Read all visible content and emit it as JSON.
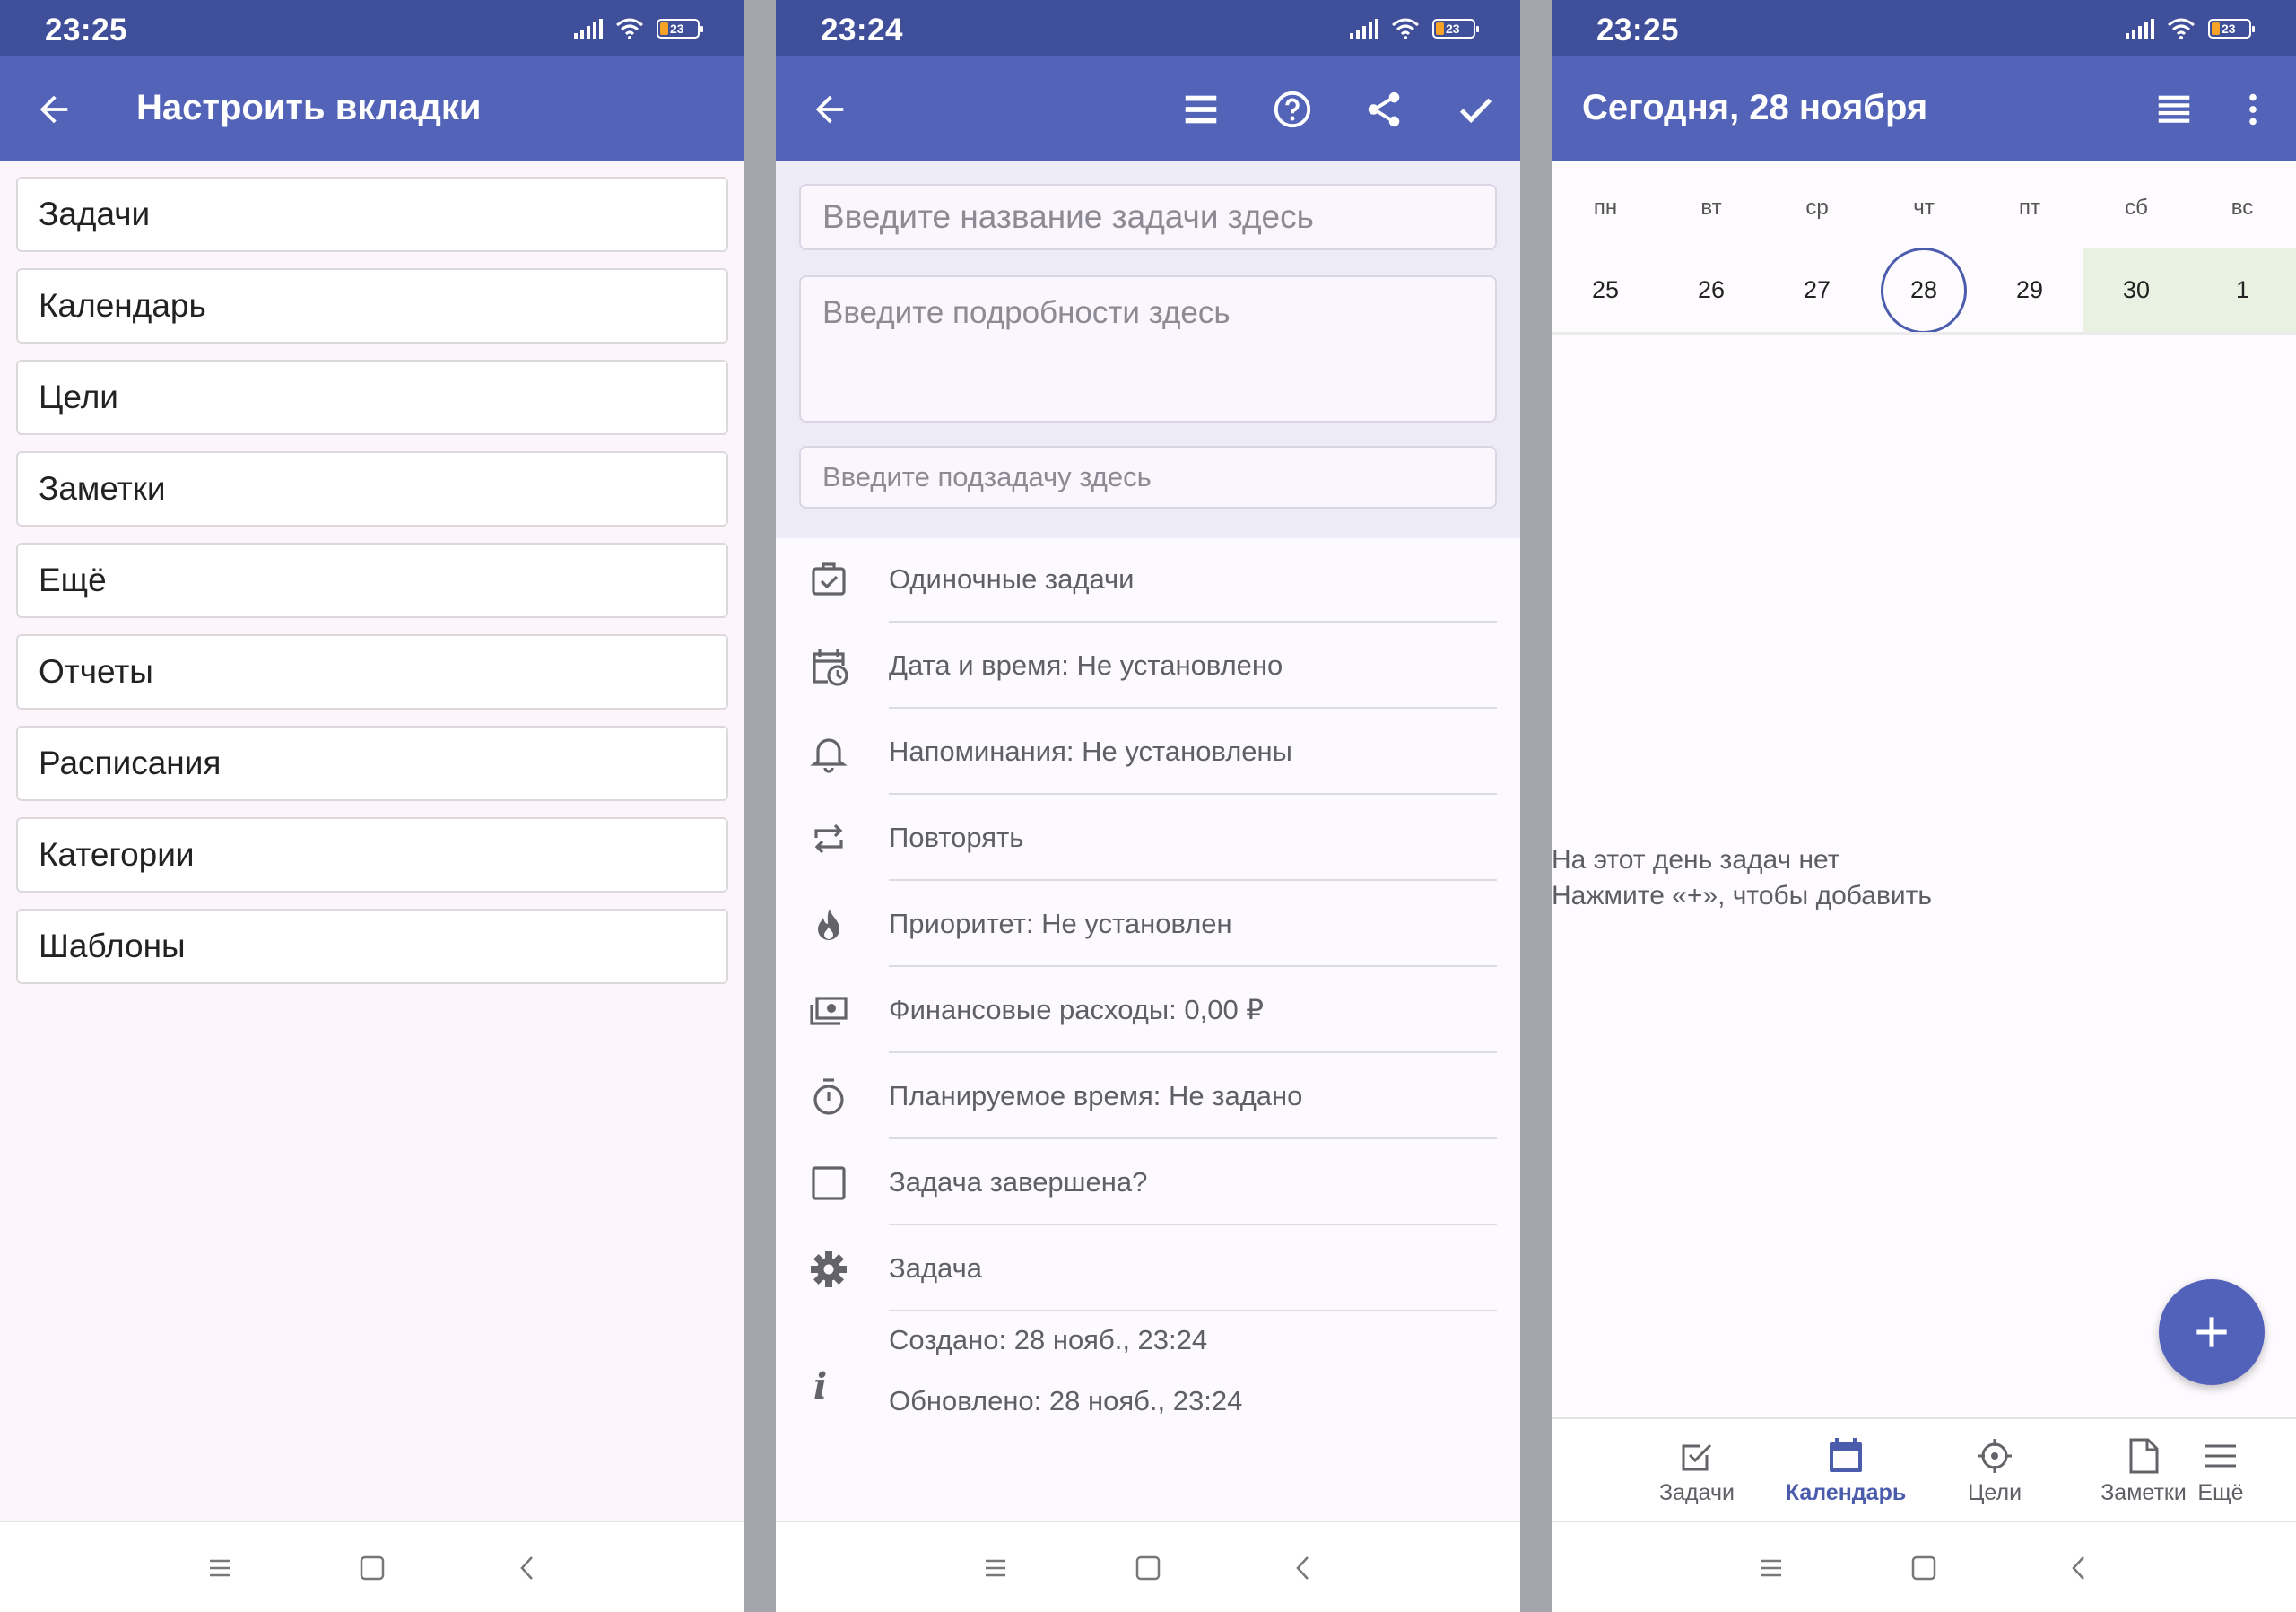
{
  "status": {
    "p1_time": "23:25",
    "p2_time": "23:24",
    "p3_time": "23:25",
    "battery": "23"
  },
  "colors": {
    "appbar": "#5363b8",
    "statusbar": "#3f4f9a",
    "accent": "#4b5cad",
    "weekend": "#e9f1e2"
  },
  "screen1": {
    "title": "Настроить вкладки",
    "tabs": [
      "Задачи",
      "Календарь",
      "Цели",
      "Заметки",
      "Ещё",
      "Отчеты",
      "Расписания",
      "Категории",
      "Шаблоны"
    ]
  },
  "screen2": {
    "title_placeholder": "Введите название задачи здесь",
    "details_placeholder": "Введите подробности здесь",
    "subtask_placeholder": "Введите подзадачу здесь",
    "toolbar_icons": [
      "back-icon",
      "list-icon",
      "help-icon",
      "share-icon",
      "check-icon"
    ],
    "rows": [
      {
        "icon": "task-type-icon",
        "label": "Одиночные задачи"
      },
      {
        "icon": "calendar-clock-icon",
        "label": "Дата и время: Не установлено"
      },
      {
        "icon": "bell-icon",
        "label": "Напоминания: Не установлены"
      },
      {
        "icon": "repeat-icon",
        "label": "Повторять"
      },
      {
        "icon": "fire-icon",
        "label": "Приоритет: Не установлен"
      },
      {
        "icon": "money-icon",
        "label": "Финансовые расходы: 0,00 ₽"
      },
      {
        "icon": "timer-icon",
        "label": "Планируемое время: Не задано"
      },
      {
        "icon": "checkbox-icon",
        "label": "Задача завершена?"
      },
      {
        "icon": "gear-icon",
        "label": "Задача"
      }
    ],
    "created": "Создано: 28 нояб., 23:24",
    "updated": "Обновлено: 28 нояб., 23:24"
  },
  "screen3": {
    "title": "Сегодня, 28 ноября",
    "weekdays": [
      "пн",
      "вт",
      "ср",
      "чт",
      "пт",
      "сб",
      "вс"
    ],
    "days": [
      "25",
      "26",
      "27",
      "28",
      "29",
      "30",
      "1"
    ],
    "selected_day": "28",
    "empty_line1": "На этот день задач нет",
    "empty_line2": "Нажмите «+», чтобы добавить",
    "bottom_tabs": [
      {
        "icon": "tasks-icon",
        "label": "Задачи",
        "active": false
      },
      {
        "icon": "calendar-icon",
        "label": "Календарь",
        "active": true
      },
      {
        "icon": "target-icon",
        "label": "Цели",
        "active": false
      },
      {
        "icon": "note-icon",
        "label": "Заметки",
        "active": false
      },
      {
        "icon": "menu-icon",
        "label": "Ещё",
        "active": false
      }
    ]
  }
}
